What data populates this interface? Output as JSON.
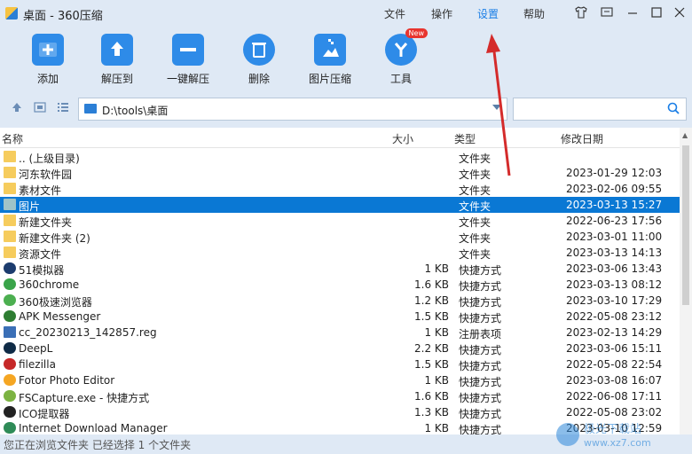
{
  "window": {
    "title": "桌面 - 360压缩"
  },
  "menu": {
    "file": "文件",
    "operate": "操作",
    "settings": "设置",
    "help": "帮助"
  },
  "toolbar": {
    "add": "添加",
    "extract_to": "解压到",
    "one_click_extract": "一键解压",
    "delete": "删除",
    "image_compress": "图片压缩",
    "tools": "工具",
    "tools_badge": "New"
  },
  "address": {
    "path": "D:\\tools\\桌面"
  },
  "search": {
    "placeholder": ""
  },
  "columns": {
    "name": "名称",
    "size": "大小",
    "type": "类型",
    "modified": "修改日期"
  },
  "files": [
    {
      "name": ".. (上级目录)",
      "size": "",
      "type": "文件夹",
      "date": "",
      "icon": "folder",
      "color": "#f6cc5d"
    },
    {
      "name": "河东软件园",
      "size": "",
      "type": "文件夹",
      "date": "2023-01-29 12:03",
      "icon": "folder",
      "color": "#f6cc5d"
    },
    {
      "name": "素材文件",
      "size": "",
      "type": "文件夹",
      "date": "2023-02-06 09:55",
      "icon": "folder",
      "color": "#f6cc5d"
    },
    {
      "name": "图片",
      "size": "",
      "type": "文件夹",
      "date": "2023-03-13 15:27",
      "icon": "folder",
      "color": "#9fc3c8"
    },
    {
      "name": "新建文件夹",
      "size": "",
      "type": "文件夹",
      "date": "2022-06-23 17:56",
      "icon": "folder",
      "color": "#f6cc5d"
    },
    {
      "name": "新建文件夹 (2)",
      "size": "",
      "type": "文件夹",
      "date": "2023-03-01 11:00",
      "icon": "folder",
      "color": "#f6cc5d"
    },
    {
      "name": "资源文件",
      "size": "",
      "type": "文件夹",
      "date": "2023-03-13 14:13",
      "icon": "folder",
      "color": "#f6cc5d"
    },
    {
      "name": "51模拟器",
      "size": "1 KB",
      "type": "快捷方式",
      "date": "2023-03-06 13:43",
      "icon": "shortcut",
      "color": "#1c3c6e"
    },
    {
      "name": "360chrome",
      "size": "1.6 KB",
      "type": "快捷方式",
      "date": "2023-03-13 08:12",
      "icon": "shortcut",
      "color": "#3aa44a"
    },
    {
      "name": "360极速浏览器",
      "size": "1.2 KB",
      "type": "快捷方式",
      "date": "2023-03-10 17:29",
      "icon": "shortcut",
      "color": "#4caf50"
    },
    {
      "name": "APK Messenger",
      "size": "1.5 KB",
      "type": "快捷方式",
      "date": "2022-05-08 23:12",
      "icon": "shortcut",
      "color": "#2e7d32"
    },
    {
      "name": "cc_20230213_142857.reg",
      "size": "1 KB",
      "type": "注册表项",
      "date": "2023-02-13 14:29",
      "icon": "reg",
      "color": "#3b6fb6"
    },
    {
      "name": "DeepL",
      "size": "2.2 KB",
      "type": "快捷方式",
      "date": "2023-03-06 15:11",
      "icon": "shortcut",
      "color": "#0f2b46"
    },
    {
      "name": "filezilla",
      "size": "1.5 KB",
      "type": "快捷方式",
      "date": "2022-05-08 22:54",
      "icon": "shortcut",
      "color": "#c62828"
    },
    {
      "name": "Fotor Photo Editor",
      "size": "1 KB",
      "type": "快捷方式",
      "date": "2023-03-08 16:07",
      "icon": "shortcut",
      "color": "#f5a623"
    },
    {
      "name": "FSCapture.exe - 快捷方式",
      "size": "1.6 KB",
      "type": "快捷方式",
      "date": "2022-06-08 17:11",
      "icon": "shortcut",
      "color": "#7cb342"
    },
    {
      "name": "ICO提取器",
      "size": "1.3 KB",
      "type": "快捷方式",
      "date": "2022-05-08 23:02",
      "icon": "shortcut",
      "color": "#222222"
    },
    {
      "name": "Internet Download Manager",
      "size": "1 KB",
      "type": "快捷方式",
      "date": "2023-03-10 12:59",
      "icon": "shortcut",
      "color": "#2e8b57"
    }
  ],
  "status": {
    "text": "您正在浏览文件夹 已经选择 1 个文件夹"
  },
  "colors": {
    "accent": "#1a7ee6",
    "selection": "#0a78d4",
    "annotation_arrow": "#d42b2b"
  }
}
